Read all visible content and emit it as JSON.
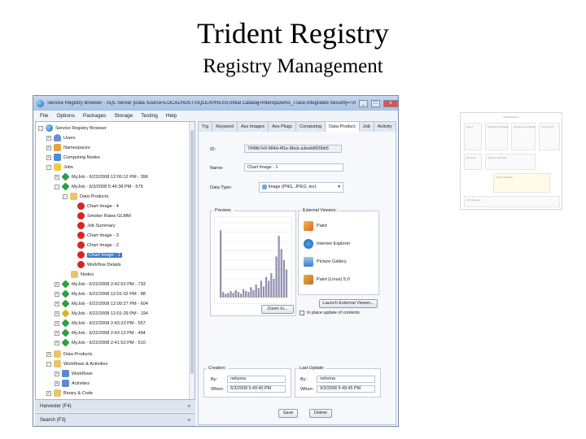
{
  "slide": {
    "title": "Trident Registry",
    "subtitle": "Registry Management"
  },
  "window": {
    "title": "Service Registry Browser - SQL Server [Data Source=LOCALHOST\\SQLEXPRESS;Initial Catalog=InteropDemo_Trace;Integrated Security=True]",
    "min": "_",
    "max": "□",
    "close": "x"
  },
  "menu": [
    "File",
    "Options",
    "Packages",
    "Storage",
    "Testing",
    "Help"
  ],
  "tree": {
    "root": "Service Registry Browser",
    "users": "Users",
    "namespaces": "Namespaces",
    "nodes": "Computing Nodes",
    "jobs": "Jobs",
    "job1": "MyJob - 6/23/2008 12:00:12 PM - 396",
    "job2": "MyJob - 6/3/2008 5:49:38 PM - 576",
    "data_products": "Data Products",
    "dp_items": [
      "Chart Image - 4",
      "Smoker Rates GLMM",
      "Job Summary",
      "Chart Image - 3",
      "Chart Image - 2",
      "Chart Image - 1",
      "Workflow Details"
    ],
    "nodes_child": "Nodes",
    "jobs_more": [
      "MyJob - 6/22/2008 2:42:53 PM - 733",
      "MyJob - 6/22/2008 12:01:02 PM - 88",
      "MyJob - 6/22/2008 12:00:27 PM - 604",
      "MyJob - 6/22/2008 12:01:29 PM - 194",
      "MyJob - 6/22/2008 2:43:23 PM - 557",
      "MyJob - 6/22/2008 2:43:13 PM - 494",
      "MyJob - 6/22/2008 2:41:53 PM - 510"
    ],
    "data_products_root": "Data Products",
    "workflows": "Workflows & Activities",
    "workflows_items": [
      "Workflows",
      "Activities"
    ],
    "binary": "Binary & Code"
  },
  "panels": {
    "harvester": "Harvester (F4)",
    "search": "Search (F3)",
    "chevron": "»"
  },
  "tabs": [
    "Trg",
    "Keyword",
    "Ass Images",
    "Ass Plugs",
    "Computing",
    "Data Product",
    "Job",
    "Activity"
  ],
  "detail": {
    "id_label": "ID:",
    "id_value": "7949b7e9-984d-4f1e-8bcb-a3eeb8f20bb5",
    "name_label": "Name:",
    "name_value": "Chart Image - 1",
    "type_label": "Data Type:",
    "type_value": "Image (PNG, JPEG, tex)",
    "preview_label": "Preview:",
    "ext_label": "External Viewers:",
    "viewers": [
      "Paint",
      "Internet Explorer",
      "Picture Gallery",
      "Paint (Linux) 5.0"
    ],
    "zoom": "Zoom In...",
    "launch": "Launch External Viewer...",
    "inplace": "In place update of contents",
    "created_label": "Creation:",
    "created_by_label": "By:",
    "created_by": "nelsona",
    "created_when_label": "When:",
    "created_when": "6/3/2008 5:49:40 PM",
    "updated_label": "Last Update:",
    "updated_by_label": "By:",
    "updated_by": "nelsona",
    "updated_when_label": "When:",
    "updated_when": "9/3/2008 5:49:45 PM",
    "save": "Save",
    "delete": "Delete"
  },
  "preview_chart": {
    "values": [
      72,
      6,
      4,
      5,
      7,
      5,
      8,
      6,
      4,
      9,
      7,
      6,
      11,
      8,
      14,
      10,
      18,
      12,
      22,
      18,
      26,
      20,
      44,
      66,
      52,
      40,
      30
    ]
  },
  "thumbnail": {
    "title": "Client/Platform",
    "boxes": [
      "Client",
      "Workflow Packages",
      "Management Studio",
      "Community",
      "Services",
      "Registry Manager",
      "Trident Registry",
      "Job Manager"
    ]
  },
  "colors": {
    "accent": "#3a7bd5",
    "titlebar": "#b7cce8",
    "bar": "#8f8fae"
  }
}
